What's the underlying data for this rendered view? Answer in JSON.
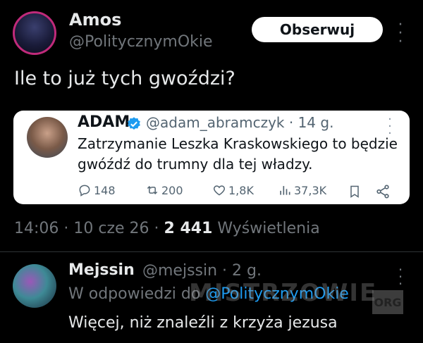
{
  "main_tweet": {
    "author_name": "Amos",
    "author_handle": "@PolitycznymOkie",
    "follow_label": "Obserwuj",
    "text": "Ile to już tych gwoździ?",
    "time": "14:06 · 10 cze 26 · ",
    "views_count": "2 441",
    "views_label": " Wyświetlenia"
  },
  "quoted_tweet": {
    "author_name": "ADAM",
    "author_handle": "@adam_abramczyk · 14 g.",
    "text": "Zatrzymanie Leszka Kraskowskiego to będzie gwóźdź do trumny dla tej władzy.",
    "stats": {
      "replies": "148",
      "retweets": "200",
      "likes": "1,8K",
      "views": "37,3K"
    }
  },
  "reply": {
    "author_name": "Mejssin",
    "author_handle": "@mejssin · 2 g.",
    "reply_to_prefix": "W odpowiedzi do ",
    "reply_to_handle": "@PolitycznymOkie",
    "text": "Więcej,  niż znaleźli z krzyża jezusa"
  },
  "watermark": {
    "text": "MISTRZOWIE",
    "suffix": "ORG"
  },
  "colors": {
    "background": "#000000",
    "link": "#1d9bf0",
    "muted": "#71767b",
    "verified": "#1d9bf0"
  }
}
